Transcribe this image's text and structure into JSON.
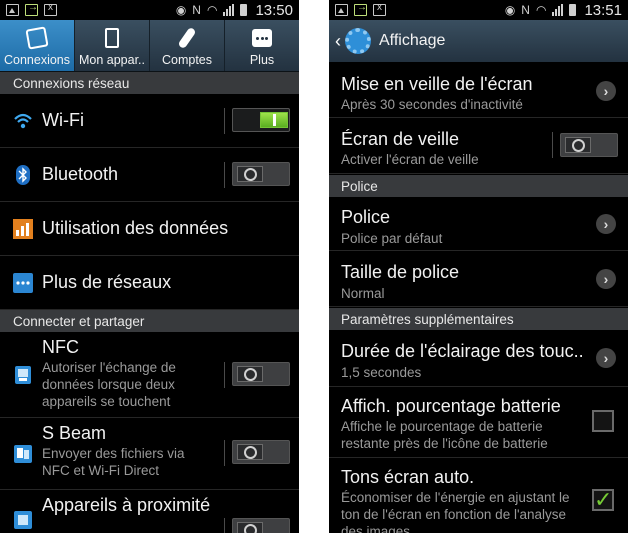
{
  "statusbar_left": {
    "time": "13:50"
  },
  "statusbar_right": {
    "time": "13:51"
  },
  "tabs": [
    {
      "label": "Connexions",
      "icon": "connections-icon"
    },
    {
      "label": "Mon appar..",
      "icon": "device-icon"
    },
    {
      "label": "Comptes",
      "icon": "accounts-icon"
    },
    {
      "label": "Plus",
      "icon": "more-icon"
    }
  ],
  "left": {
    "section1": "Connexions réseau",
    "wifi": "Wi-Fi",
    "bluetooth": "Bluetooth",
    "data_usage": "Utilisation des données",
    "more_networks": "Plus de réseaux",
    "section2": "Connecter et partager",
    "nfc_title": "NFC",
    "nfc_sub": "Autoriser l'échange de données lorsque deux appareils se touchent",
    "sbeam_title": "S Beam",
    "sbeam_sub": "Envoyer des fichiers via NFC et Wi-Fi Direct",
    "nearby_title": "Appareils à proximité"
  },
  "right": {
    "title": "Affichage",
    "sleep_title": "Mise en veille de l'écran",
    "sleep_sub": "Après 30 secondes d'inactivité",
    "daydream_title": "Écran de veille",
    "daydream_sub": "Activer l'écran de veille",
    "section_font": "Police",
    "font_title": "Police",
    "font_sub": "Police par défaut",
    "fontsize_title": "Taille de police",
    "fontsize_sub": "Normal",
    "section_extra": "Paramètres supplémentaires",
    "touch_title": "Durée de l'éclairage des touc..",
    "touch_sub": "1,5 secondes",
    "battery_title": "Affich. pourcentage batterie",
    "battery_sub": "Affiche le pourcentage de batterie restante près de l'icône de batterie",
    "autotone_title": "Tons écran auto.",
    "autotone_sub": "Économiser de l'énergie en ajustant le ton de l'écran en fonction de l'analyse des images"
  },
  "colors": {
    "accent_blue": "#2b7fc0",
    "toggle_on": "#7ed23a"
  }
}
